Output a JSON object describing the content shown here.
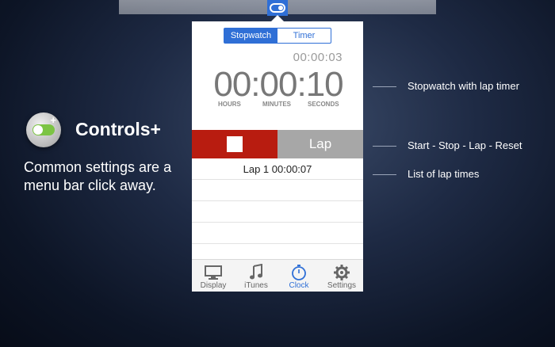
{
  "promo": {
    "title": "Controls+",
    "tagline": "Common settings are a menu bar click away."
  },
  "stopwatch": {
    "tabs": [
      "Stopwatch",
      "Timer"
    ],
    "active_tab": "Stopwatch",
    "lap_time": "00:00:03",
    "main_time": "00:00:10",
    "units": [
      "HOURS",
      "MINUTES",
      "SECONDS"
    ],
    "lap_button_label": "Lap",
    "laps": [
      "Lap 1  00:00:07",
      "",
      "",
      "",
      ""
    ]
  },
  "tabbar": {
    "items": [
      {
        "label": "Display",
        "icon": "display-icon"
      },
      {
        "label": "iTunes",
        "icon": "music-note-icon"
      },
      {
        "label": "Clock",
        "icon": "stopwatch-icon"
      },
      {
        "label": "Settings",
        "icon": "gear-icon"
      }
    ],
    "active": "Clock"
  },
  "callouts": [
    "Stopwatch with lap timer",
    "Start - Stop - Lap - Reset",
    "List of lap times"
  ],
  "colors": {
    "accent": "#2f6fd6",
    "stop": "#b81c10",
    "lap": "#a7a7a7"
  }
}
